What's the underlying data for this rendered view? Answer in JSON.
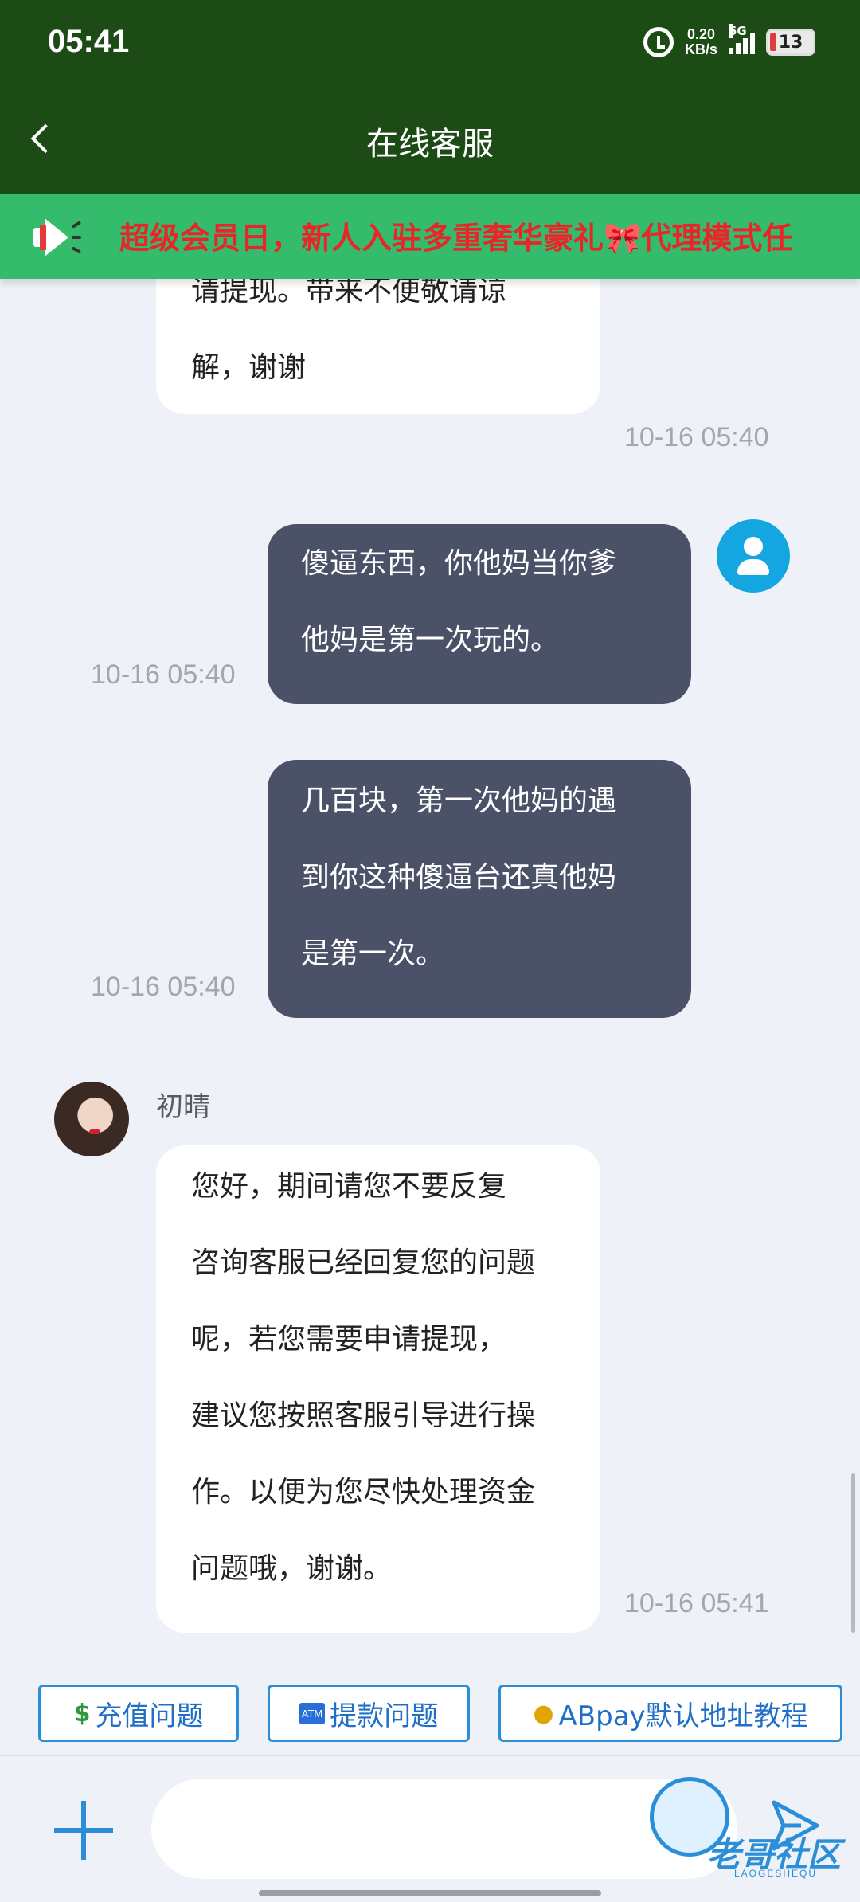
{
  "status_bar": {
    "time": "05:41",
    "net_speed_value": "0.20",
    "net_speed_unit": "KB/s",
    "signal_label": "5G",
    "battery": "13"
  },
  "header": {
    "title": "在线客服"
  },
  "marquee": {
    "text": "超级会员日，新人入驻多重奢华豪礼🎀代理模式任"
  },
  "messages": [
    {
      "side": "agent",
      "text_lines": [
        "请提现。带来不便敬请谅",
        "解，谢谢"
      ],
      "time": "10-16 05:40"
    },
    {
      "side": "user",
      "text_lines": [
        "傻逼东西，你他妈当你爹",
        "他妈是第一次玩的。"
      ],
      "time": "10-16 05:40"
    },
    {
      "side": "user",
      "text_lines": [
        "几百块，第一次他妈的遇",
        "到你这种傻逼台还真他妈",
        "是第一次。"
      ],
      "time": "10-16 05:40"
    },
    {
      "side": "agent",
      "sender": "初晴",
      "text_lines": [
        "您好，期间请您不要反复",
        "咨询客服已经回复您的问题",
        "呢，若您需要申请提现，",
        "建议您按照客服引导进行操",
        "作。以便为您尽快处理资金",
        "问题哦，谢谢。"
      ],
      "time": "10-16 05:41"
    }
  ],
  "quick_replies": [
    {
      "icon": "money-icon",
      "label": "充值问题"
    },
    {
      "icon": "atm-icon",
      "icon_text": "ATM",
      "label": "提款问题"
    },
    {
      "icon": "money-bag-icon",
      "label": "ABpay默认地址教程"
    }
  ],
  "watermark": {
    "text": "老哥社区",
    "sub": "LAOGESHEQU"
  },
  "colors": {
    "header_bg": "#1d4b16",
    "marquee_bg": "#35bb6c",
    "marquee_text": "#e8262a",
    "user_bubble": "#4b5268",
    "agent_bubble": "#ffffff",
    "accent": "#2a8fd8"
  }
}
